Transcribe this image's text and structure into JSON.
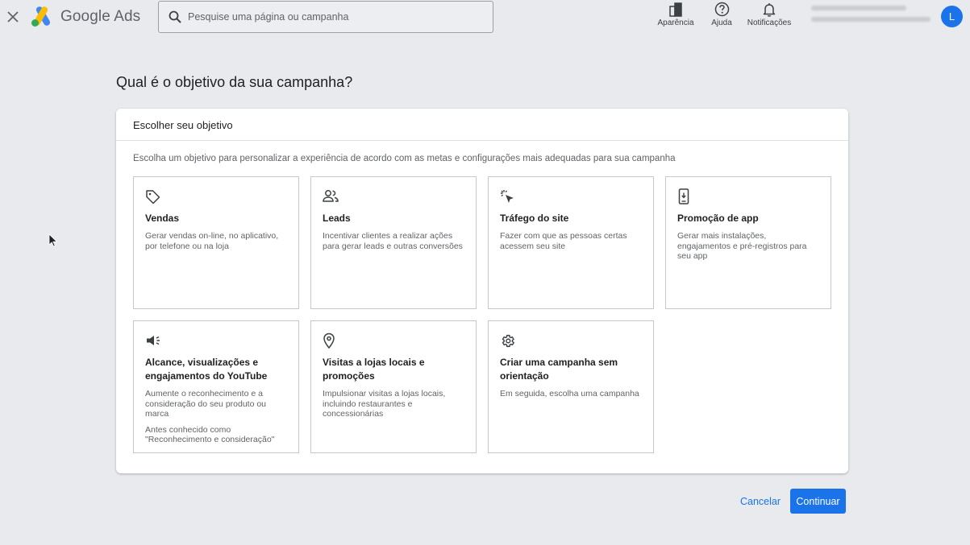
{
  "header": {
    "brand": "Google Ads",
    "search_placeholder": "Pesquise uma página ou campanha",
    "actions": [
      {
        "label": "Aparência",
        "icon": "appearance-icon"
      },
      {
        "label": "Ajuda",
        "icon": "help-icon"
      },
      {
        "label": "Notificações",
        "icon": "bell-icon"
      }
    ],
    "avatar_initial": "L"
  },
  "page": {
    "title": "Qual é o objetivo da sua campanha?"
  },
  "card": {
    "header": "Escolher seu objetivo",
    "description": "Escolha um objetivo para personalizar a experiência de acordo com as metas e configurações mais adequadas para sua campanha",
    "objectives": [
      {
        "title": "Vendas",
        "description": "Gerar vendas on-line, no aplicativo, por telefone ou na loja",
        "icon": "tag-icon"
      },
      {
        "title": "Leads",
        "description": "Incentivar clientes a realizar ações para gerar leads e outras conversões",
        "icon": "people-icon"
      },
      {
        "title": "Tráfego do site",
        "description": "Fazer com que as pessoas certas acessem seu site",
        "icon": "cursor-click-icon"
      },
      {
        "title": "Promoção de app",
        "description": "Gerar mais instalações, engajamentos e pré-registros para seu app",
        "icon": "phone-icon"
      },
      {
        "title": "Alcance, visualizações e engajamentos do YouTube",
        "description": "Aumente o reconhecimento e a consideração do seu produto ou marca",
        "note": "Antes conhecido como \"Reconhecimento e consideração\"",
        "icon": "megaphone-icon"
      },
      {
        "title": "Visitas a lojas locais e promoções",
        "description": "Impulsionar visitas a lojas locais, incluindo restaurantes e concessionárias",
        "icon": "location-pin-icon"
      },
      {
        "title": "Criar uma campanha sem orientação",
        "description": "Em seguida, escolha uma campanha",
        "icon": "gear-icon"
      }
    ]
  },
  "footer": {
    "cancel_label": "Cancelar",
    "continue_label": "Continuar"
  },
  "colors": {
    "accent": "#1a73e8",
    "background": "#e8eaed"
  }
}
